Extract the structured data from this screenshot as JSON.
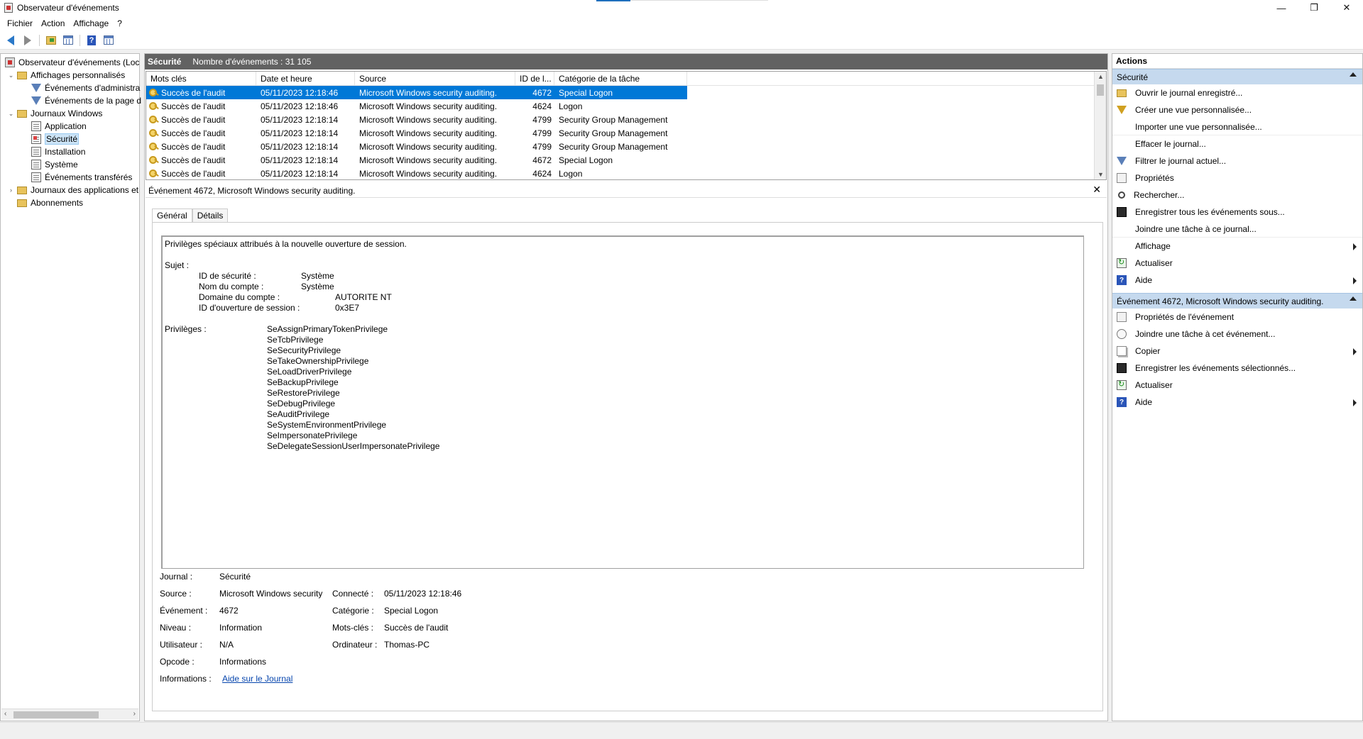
{
  "window": {
    "title": "Observateur d'événements"
  },
  "menu": [
    "Fichier",
    "Action",
    "Affichage",
    "?"
  ],
  "tree": [
    {
      "label": "Observateur d'événements (Loc",
      "icon": "event-viewer-icon"
    },
    {
      "label": "Affichages personnalisés",
      "icon": "folder-icon"
    },
    {
      "label": "Événements d'administra",
      "icon": "filter-icon"
    },
    {
      "label": "Événements de la page d",
      "icon": "filter-icon"
    },
    {
      "label": "Journaux Windows",
      "icon": "folder-icon"
    },
    {
      "label": "Application",
      "icon": "log-icon"
    },
    {
      "label": "Sécurité",
      "icon": "log-icon"
    },
    {
      "label": "Installation",
      "icon": "log-icon"
    },
    {
      "label": "Système",
      "icon": "log-icon"
    },
    {
      "label": "Événements transférés",
      "icon": "log-icon"
    },
    {
      "label": "Journaux des applications et",
      "icon": "folder-icon"
    },
    {
      "label": "Abonnements",
      "icon": "folder-icon"
    }
  ],
  "center": {
    "log_name": "Sécurité",
    "event_count": "Nombre d'événements : 31 105",
    "columns": [
      "Mots clés",
      "Date et heure",
      "Source",
      "ID de l...",
      "Catégorie de la tâche"
    ],
    "rows": [
      [
        "Succès de l'audit",
        "05/11/2023 12:18:46",
        "Microsoft Windows security auditing.",
        "4672",
        "Special Logon"
      ],
      [
        "Succès de l'audit",
        "05/11/2023 12:18:46",
        "Microsoft Windows security auditing.",
        "4624",
        "Logon"
      ],
      [
        "Succès de l'audit",
        "05/11/2023 12:18:14",
        "Microsoft Windows security auditing.",
        "4799",
        "Security Group Management"
      ],
      [
        "Succès de l'audit",
        "05/11/2023 12:18:14",
        "Microsoft Windows security auditing.",
        "4799",
        "Security Group Management"
      ],
      [
        "Succès de l'audit",
        "05/11/2023 12:18:14",
        "Microsoft Windows security auditing.",
        "4799",
        "Security Group Management"
      ],
      [
        "Succès de l'audit",
        "05/11/2023 12:18:14",
        "Microsoft Windows security auditing.",
        "4672",
        "Special Logon"
      ],
      [
        "Succès de l'audit",
        "05/11/2023 12:18:14",
        "Microsoft Windows security auditing.",
        "4624",
        "Logon"
      ]
    ]
  },
  "detail": {
    "title": "Événement 4672, Microsoft Windows security auditing.",
    "tabs": [
      "Général",
      "Détails"
    ],
    "message": {
      "intro": "Privilèges spéciaux attribués à la nouvelle ouverture de session.",
      "subject_label": "Sujet :",
      "subject": [
        [
          "ID de sécurité :",
          "Système"
        ],
        [
          "Nom du compte :",
          "Système"
        ],
        [
          "Domaine du compte :",
          "AUTORITE NT"
        ],
        [
          "ID d'ouverture de session :",
          "0x3E7"
        ]
      ],
      "privileges_label": "Privilèges :",
      "privileges": [
        "SeAssignPrimaryTokenPrivilege",
        "SeTcbPrivilege",
        "SeSecurityPrivilege",
        "SeTakeOwnershipPrivilege",
        "SeLoadDriverPrivilege",
        "SeBackupPrivilege",
        "SeRestorePrivilege",
        "SeDebugPrivilege",
        "SeAuditPrivilege",
        "SeSystemEnvironmentPrivilege",
        "SeImpersonatePrivilege",
        "SeDelegateSessionUserImpersonatePrivilege"
      ]
    },
    "meta": {
      "journal_label": "Journal :",
      "journal": "Sécurité",
      "source_label": "Source :",
      "source": "Microsoft Windows security",
      "connected_label": "Connecté :",
      "connected": "05/11/2023 12:18:46",
      "event_label": "Événement :",
      "event": "4672",
      "category_label": "Catégorie :",
      "category": "Special Logon",
      "level_label": "Niveau :",
      "level": "Information",
      "keywords_label": "Mots-clés :",
      "keywords": "Succès de l'audit",
      "user_label": "Utilisateur :",
      "user": "N/A",
      "computer_label": "Ordinateur :",
      "computer": "Thomas-PC",
      "opcode_label": "Opcode :",
      "opcode": "Informations",
      "info_label": "Informations :",
      "info_link": "Aide sur le Journal"
    }
  },
  "actions": {
    "header": "Actions",
    "section1": "Sécurité",
    "items1": [
      {
        "label": "Ouvrir le journal enregistré...",
        "icon": "open-log-icon"
      },
      {
        "label": "Créer une vue personnalisée...",
        "icon": "create-view-icon"
      },
      {
        "label": "Importer une vue personnalisée...",
        "icon": ""
      },
      {
        "label": "Effacer le journal...",
        "icon": ""
      },
      {
        "label": "Filtrer le journal actuel...",
        "icon": "filter-icon"
      },
      {
        "label": "Propriétés",
        "icon": "properties-icon"
      },
      {
        "label": "Rechercher...",
        "icon": "search-icon"
      },
      {
        "label": "Enregistrer tous les événements sous...",
        "icon": "save-icon"
      },
      {
        "label": "Joindre une tâche à ce journal...",
        "icon": ""
      },
      {
        "label": "Affichage",
        "icon": "",
        "submenu": true
      },
      {
        "label": "Actualiser",
        "icon": "refresh-icon"
      },
      {
        "label": "Aide",
        "icon": "help-icon",
        "submenu": true
      }
    ],
    "section2": "Événement 4672, Microsoft Windows security auditing.",
    "items2": [
      {
        "label": "Propriétés de l'événement",
        "icon": "event-properties-icon"
      },
      {
        "label": "Joindre une tâche à cet événement...",
        "icon": "attach-task-icon"
      },
      {
        "label": "Copier",
        "icon": "copy-icon",
        "submenu": true
      },
      {
        "label": "Enregistrer les événements sélectionnés...",
        "icon": "save-icon"
      },
      {
        "label": "Actualiser",
        "icon": "refresh-icon"
      },
      {
        "label": "Aide",
        "icon": "help-icon",
        "submenu": true
      }
    ]
  }
}
